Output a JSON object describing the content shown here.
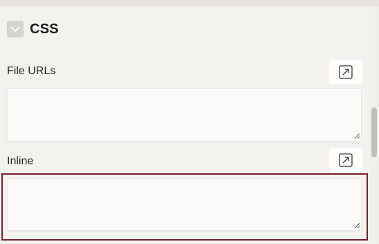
{
  "section": {
    "title": "CSS",
    "toggle_icon": "chevron-down-icon"
  },
  "fields": {
    "file_urls": {
      "label": "File URLs",
      "value": "",
      "expand_icon": "expand-arrow-icon"
    },
    "inline": {
      "label": "Inline",
      "value": "",
      "expand_icon": "expand-arrow-icon"
    }
  },
  "colors": {
    "focus_ring": "#7c1e2c",
    "panel_background": "#f4f2ef",
    "input_background": "#fbfaf8",
    "toggle_background": "#d6d2cc"
  }
}
